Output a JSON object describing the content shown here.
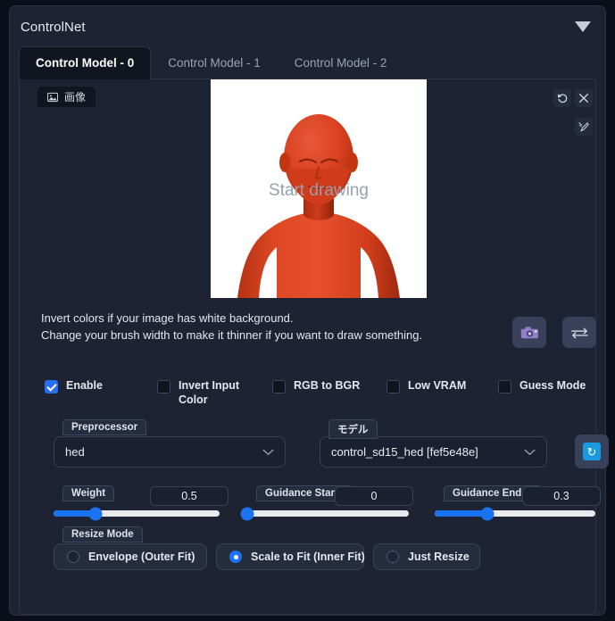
{
  "panel": {
    "title": "ControlNet",
    "collapse_icon": "chevron-down-icon"
  },
  "tabs": [
    {
      "label": "Control Model - 0",
      "active": true
    },
    {
      "label": "Control Model - 1",
      "active": false
    },
    {
      "label": "Control Model - 2",
      "active": false
    }
  ],
  "image_tab": {
    "label": "画像",
    "icon": "image-icon"
  },
  "canvas": {
    "hint": "Start drawing",
    "background_color": "#ffffff",
    "figure_color": "#d8401f",
    "figure_shadow_color": "#a82c11",
    "figure_description": "red 3d mannequin bust"
  },
  "canvas_tools": [
    {
      "name": "undo-icon",
      "title": "undo"
    },
    {
      "name": "close-icon",
      "title": "clear"
    },
    {
      "name": "brush-icon",
      "title": "brush"
    }
  ],
  "hints": {
    "line1": "Invert colors if your image has white background.",
    "line2": "Change your brush width to make it thinner if you want to draw something."
  },
  "action_buttons": [
    {
      "name": "webcam-icon",
      "label": ""
    },
    {
      "name": "swap-arrows-icon",
      "label": ""
    }
  ],
  "checkboxes": [
    {
      "label": "Enable",
      "checked": true
    },
    {
      "label": "Invert Input Color",
      "checked": false
    },
    {
      "label": "RGB to BGR",
      "checked": false
    },
    {
      "label": "Low VRAM",
      "checked": false
    },
    {
      "label": "Guess Mode",
      "checked": false
    }
  ],
  "preprocessor": {
    "label": "Preprocessor",
    "value": "hed"
  },
  "model": {
    "label": "モデル",
    "value": "control_sd15_hed [fef5e48e]",
    "refresh_icon": "refresh-icon",
    "refresh_color": "#1a9ae0"
  },
  "sliders": [
    {
      "label": "Weight",
      "value": "0.5",
      "percent": 25
    },
    {
      "label": "Guidance Start (",
      "value": "0",
      "percent": 0
    },
    {
      "label": "Guidance End (T",
      "value": "0.3",
      "percent": 30
    }
  ],
  "resize_mode": {
    "label": "Resize Mode",
    "options": [
      {
        "label": "Envelope (Outer Fit)",
        "selected": false
      },
      {
        "label": "Scale to Fit (Inner Fit)",
        "selected": true
      },
      {
        "label": "Just Resize",
        "selected": false
      }
    ]
  },
  "colors": {
    "accent": "#1a73f0",
    "panel_bg": "#1d2333",
    "page_bg": "#0b0f19",
    "border": "#2c3347"
  }
}
